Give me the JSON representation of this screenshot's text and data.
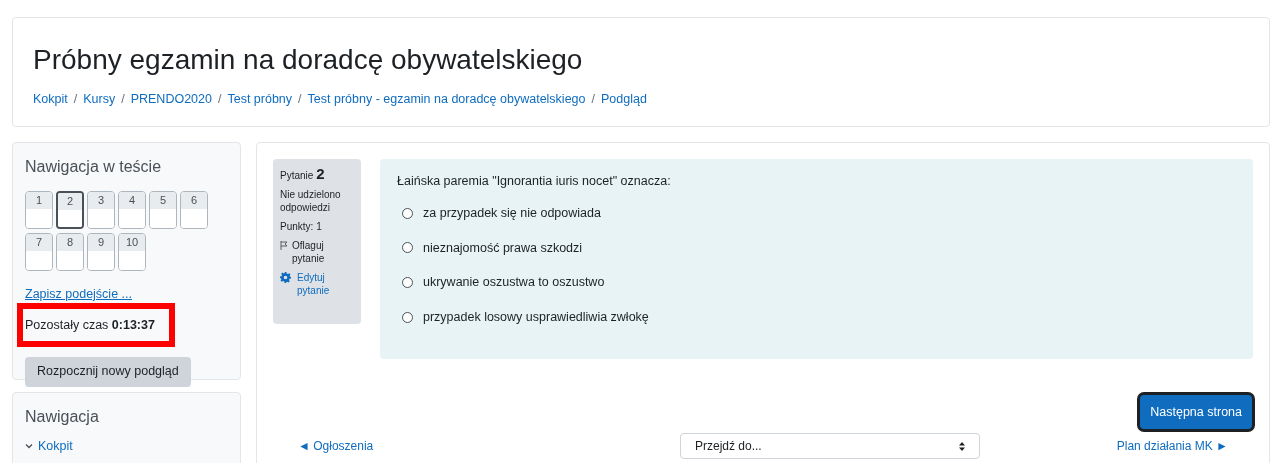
{
  "header": {
    "title": "Próbny egzamin na doradcę obywatelskiego",
    "breadcrumbs": [
      "Kokpit",
      "Kursy",
      "PRENDO2020",
      "Test próbny",
      "Test próbny - egzamin na doradcę obywatelskiego",
      "Podgląd"
    ],
    "breadcrumb_separators": [
      "/",
      "/",
      "/",
      "/",
      "/"
    ]
  },
  "quiz_nav": {
    "title": "Nawigacja w teście",
    "questions": [
      {
        "label": "1",
        "selected": false
      },
      {
        "label": "2",
        "selected": true
      },
      {
        "label": "3",
        "selected": false
      },
      {
        "label": "4",
        "selected": false
      },
      {
        "label": "5",
        "selected": false
      },
      {
        "label": "6",
        "selected": false
      },
      {
        "label": "7",
        "selected": false
      },
      {
        "label": "8",
        "selected": false
      },
      {
        "label": "9",
        "selected": false
      },
      {
        "label": "10",
        "selected": false
      }
    ],
    "save_link": "Zapisz podejście ...",
    "timer": {
      "label": "Pozostały czas",
      "value": "0:13:37",
      "highlighted": true
    },
    "restart_button": "Rozpocznij nowy podgląd"
  },
  "navigation": {
    "title": "Nawigacja",
    "items": [
      {
        "label": "Kokpit",
        "expanded": true
      }
    ]
  },
  "question": {
    "number_label": "Pytanie",
    "number": "2",
    "status": "Nie udzielono odpowiedzi",
    "points": "Punkty: 1",
    "flag_label": "Oflaguj pytanie",
    "edit_label": "Edytuj pytanie",
    "prompt": "Łaińska paremia \"Ignorantia iuris nocet\" oznacza:",
    "options": [
      {
        "label": "za przypadek się nie odpowiada",
        "selected": false
      },
      {
        "label": "nieznajomość prawa szkodzi",
        "selected": false
      },
      {
        "label": "ukrywanie oszustwa to oszustwo",
        "selected": false
      },
      {
        "label": "przypadek losowy usprawiedliwia zwłokę",
        "selected": false
      }
    ]
  },
  "next_button": "Następna strona",
  "footer": {
    "prev_link": "◄ Ogłoszenia",
    "jump_select": "Przejdź do...",
    "next_link": "Plan działania MK ►"
  }
}
